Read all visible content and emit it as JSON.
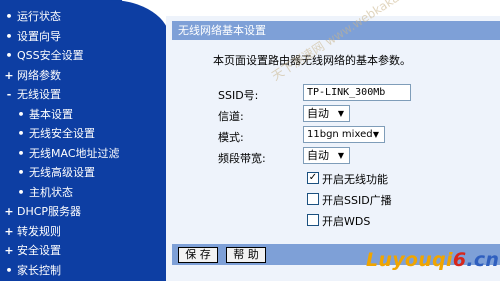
{
  "sidebar": {
    "items": [
      {
        "marker": "•",
        "label": "运行状态",
        "sub": false
      },
      {
        "marker": "•",
        "label": "设置向导",
        "sub": false
      },
      {
        "marker": "•",
        "label": "QSS安全设置",
        "sub": false
      },
      {
        "marker": "+",
        "label": "网络参数",
        "sub": false
      },
      {
        "marker": "-",
        "label": "无线设置",
        "sub": false
      },
      {
        "marker": "•",
        "label": "基本设置",
        "sub": true,
        "active": true
      },
      {
        "marker": "•",
        "label": "无线安全设置",
        "sub": true
      },
      {
        "marker": "•",
        "label": "无线MAC地址过滤",
        "sub": true
      },
      {
        "marker": "•",
        "label": "无线高级设置",
        "sub": true
      },
      {
        "marker": "•",
        "label": "主机状态",
        "sub": true
      },
      {
        "marker": "+",
        "label": "DHCP服务器",
        "sub": false
      },
      {
        "marker": "+",
        "label": "转发规则",
        "sub": false
      },
      {
        "marker": "+",
        "label": "安全设置",
        "sub": false
      },
      {
        "marker": "•",
        "label": "家长控制",
        "sub": false
      }
    ]
  },
  "panel": {
    "title": "无线网络基本设置",
    "description": "本页面设置路由器无线网络的基本参数。",
    "ssid_label": "SSID号:",
    "ssid_value": "TP-LINK_300Mb",
    "channel_label": "信道:",
    "channel_value": "自动",
    "mode_label": "模式:",
    "mode_value": "11bgn mixed",
    "bandwidth_label": "频段带宽:",
    "bandwidth_value": "自动",
    "checkboxes": [
      {
        "label": "开启无线功能",
        "checked": true
      },
      {
        "label": "开启SSID广播",
        "checked": false
      },
      {
        "label": "开启WDS",
        "checked": false
      }
    ]
  },
  "buttons": {
    "save": "保 存",
    "help": "帮 助"
  },
  "watermark": "天下测速网 www.webkaka.com",
  "brand": {
    "part1": "Luyouqi",
    "part2": "6",
    "part3": ".cn"
  },
  "colors": {
    "sidebar": "#0d3ea3",
    "title_bar": "#7ea0d7",
    "panel_bg": "#eef3fb"
  }
}
